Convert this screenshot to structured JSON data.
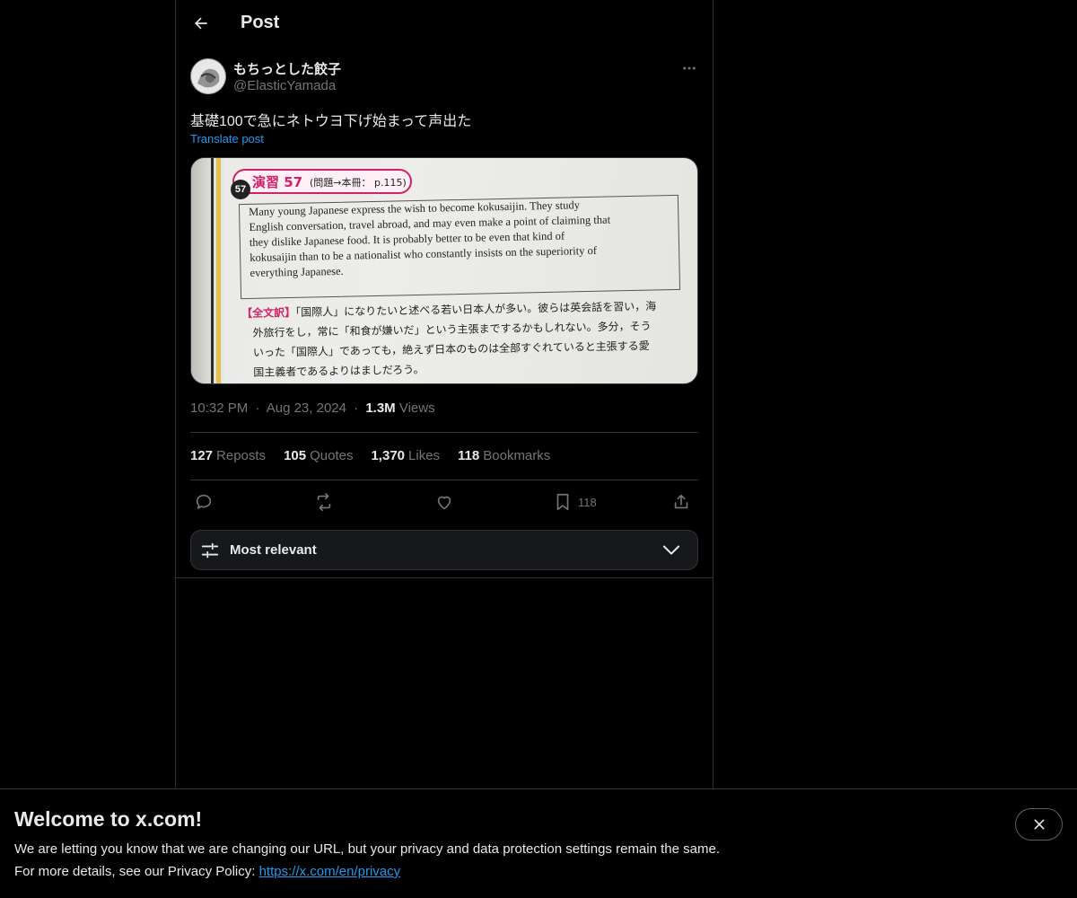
{
  "header": {
    "title": "Post",
    "back_icon": "arrow-left-icon"
  },
  "author": {
    "name": "もちっとした餃子",
    "handle": "@ElasticYamada"
  },
  "post": {
    "text": "基礎100で急にネトウヨ下げ始まって声出た",
    "translate_label": "Translate post",
    "time": "10:32 PM",
    "date": "Aug 23, 2024",
    "views_count": "1.3M",
    "views_label": "Views",
    "separator": "·"
  },
  "media": {
    "badge_number": "57",
    "badge_title": "演習 57",
    "badge_ref": "(問題→本冊： p.115)",
    "en_lines": [
      "Many young Japanese express the wish to become kokusaijin. They study",
      "English conversation, travel abroad, and may even make a point of claiming that",
      "they dislike Japanese food. It is probably better to be even that kind of",
      "kokusaijin than to be a nationalist who constantly insists on the superiority of",
      "everything Japanese."
    ],
    "jp_label": "【全文訳】",
    "jp_lines": [
      "「国際人」になりたいと述べる若い日本人が多い。彼らは英会話を習い，海",
      "外旅行をし，常に「和食が嫌いだ」という主張までするかもしれない。多分，そう",
      "いった「国際人」であっても，絶えず日本のものは全部すぐれていると主張する愛",
      "国主義者であるよりはましだろう。"
    ]
  },
  "stats": [
    {
      "count": "127",
      "label": "Reposts"
    },
    {
      "count": "105",
      "label": "Quotes"
    },
    {
      "count": "1,370",
      "label": "Likes"
    },
    {
      "count": "118",
      "label": "Bookmarks"
    }
  ],
  "actions": {
    "reply_icon": "reply-icon",
    "repost_icon": "repost-icon",
    "like_icon": "heart-icon",
    "bookmark_icon": "bookmark-icon",
    "bookmark_count": "118",
    "share_icon": "share-icon"
  },
  "sort": {
    "label": "Most relevant",
    "icon": "sliders-icon",
    "chevron": "chevron-down-icon"
  },
  "banner": {
    "title": "Welcome to x.com!",
    "line1": "We are letting you know that we are changing our URL, but your privacy and data protection settings remain the same.",
    "line2_prefix": "For more details, see our Privacy Policy: ",
    "link_text": "https://x.com/en/privacy",
    "close_icon": "close-icon"
  },
  "colors": {
    "accent": "#1d9bf0",
    "background": "#000000",
    "border": "#2f3336",
    "muted": "#71767b",
    "text": "#e7e9ea"
  }
}
